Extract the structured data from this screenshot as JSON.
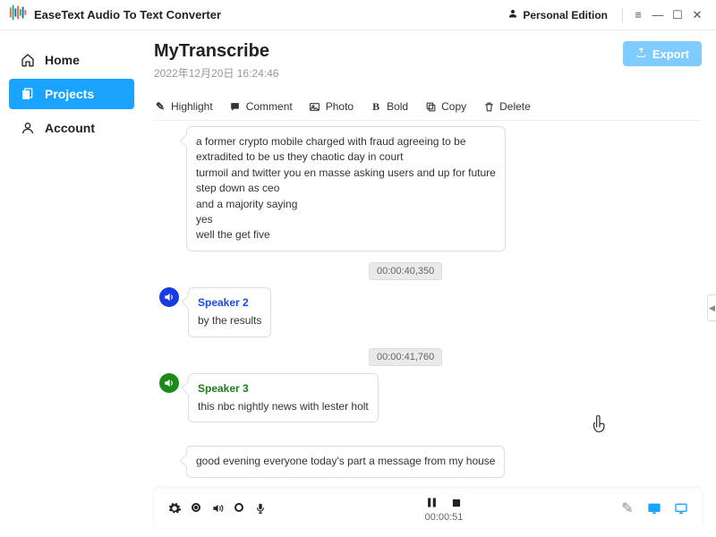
{
  "app": {
    "title": "EaseText Audio To Text Converter",
    "edition": "Personal Edition"
  },
  "sidebar": {
    "items": [
      {
        "label": "Home"
      },
      {
        "label": "Projects"
      },
      {
        "label": "Account"
      }
    ]
  },
  "page": {
    "title": "MyTranscribe",
    "date": "2022年12月20日 16:24:46",
    "export_label": "Export"
  },
  "toolbar": {
    "highlight": "Highlight",
    "comment": "Comment",
    "photo": "Photo",
    "bold": "Bold",
    "copy": "Copy",
    "delete": "Delete"
  },
  "transcript": {
    "block0": "a former crypto mobile charged with fraud agreeing to be\nextradited to be us they chaotic day in court\nturmoil and twitter you en masse asking users and up for future\nstep down as ceo\nand a majority saying\nyes\nwell the get five",
    "ts1": "00:00:40,350",
    "speaker2": "Speaker 2",
    "block2": "by the results",
    "ts2": "00:00:41,760",
    "speaker3": "Speaker 3",
    "block3": "this nbc nightly news with lester holt",
    "block4": "good evening everyone today's part a message from my house"
  },
  "player": {
    "time": "00:00:51"
  },
  "colors": {
    "accent": "#1aa3ff",
    "speaker2_badge": "#1a3be0",
    "speaker3_badge": "#1a8a1a"
  }
}
